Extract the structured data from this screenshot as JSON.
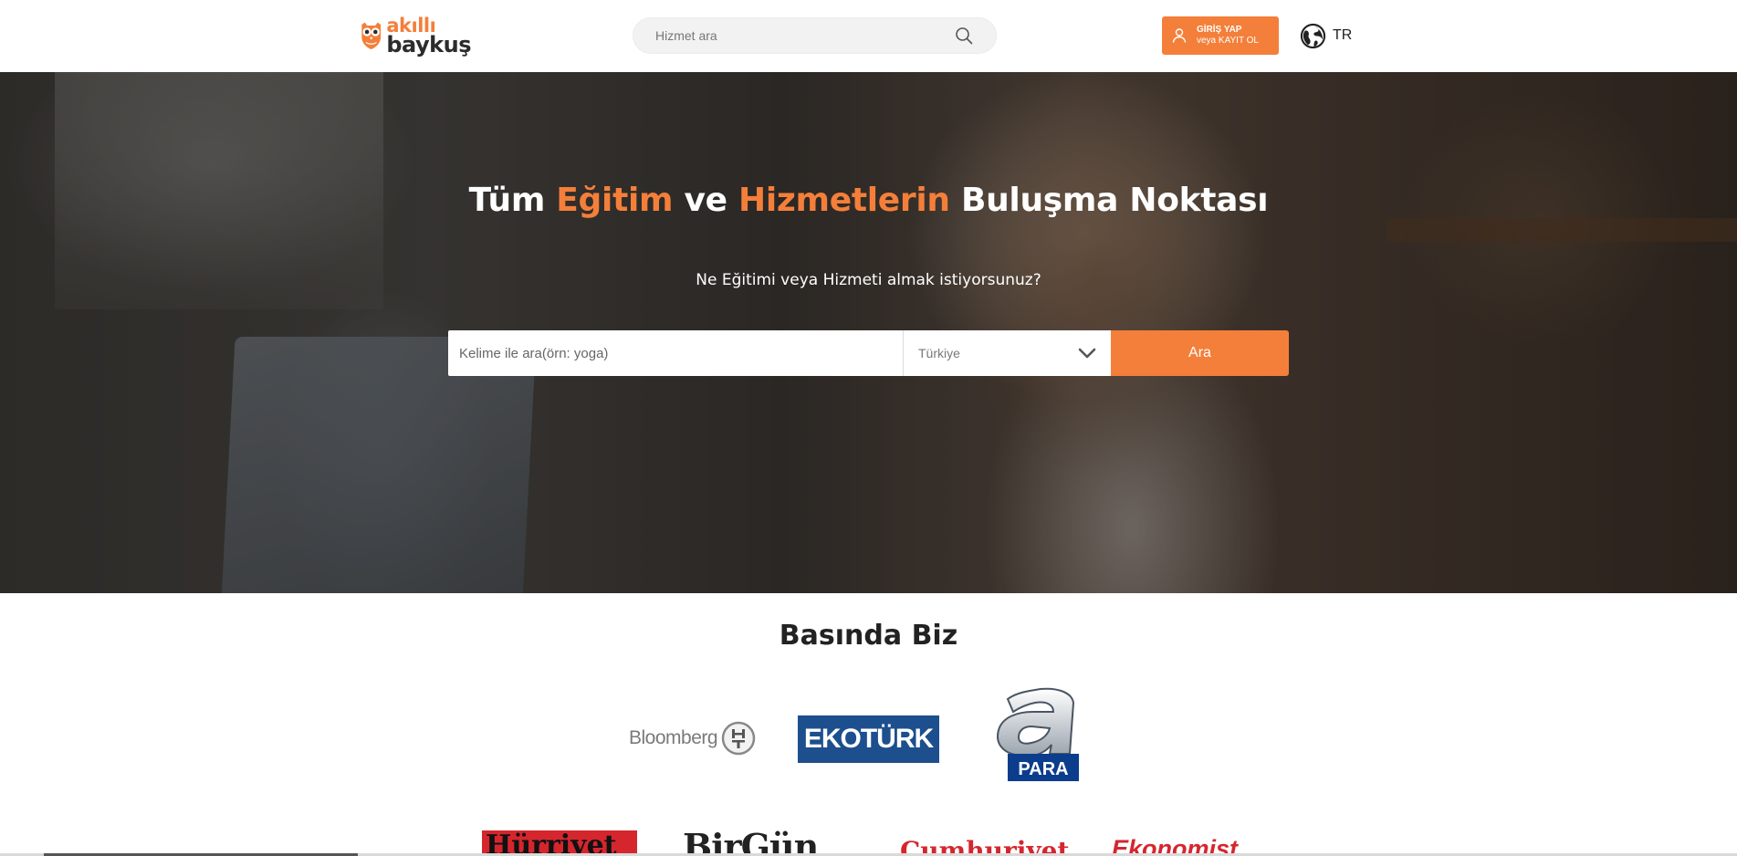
{
  "header": {
    "logo": {
      "line1": "akıllı",
      "line2": "baykuş"
    },
    "search": {
      "placeholder": "Hizmet ara",
      "icon": "search-icon"
    },
    "login": {
      "line1": "GİRİŞ YAP",
      "line2": "veya KAYIT OL",
      "icon": "user-icon"
    },
    "language": {
      "code": "TR",
      "icon": "globe-icon"
    }
  },
  "hero": {
    "title": {
      "part1": "Tüm ",
      "accent1": "Eğitim",
      "part2": " ve ",
      "accent2": "Hizmetlerin",
      "part3": " Buluşma Noktası"
    },
    "subtitle": "Ne Eğitimi veya Hizmeti almak istiyorsunuz?",
    "search": {
      "keyword_placeholder": "Kelime ile ara(örn: yoga)",
      "country_value": "Türkiye",
      "button_label": "Ara"
    }
  },
  "press": {
    "title": "Basında Biz",
    "logos_row1": {
      "bloomberg": "Bloomberg",
      "bloomberg_badge": "HT",
      "ekoturk": "EKOTÜRK",
      "apara": "PARA"
    },
    "logos_row2": {
      "hurriyet": "Hürriyet",
      "birgun": "BirGün",
      "cumhuriyet": "Cumhuriyet",
      "ekonomist": "Ekonomist"
    }
  },
  "colors": {
    "accent": "#f47f3a",
    "ekoturk_blue": "#1d4f8e",
    "red": "#d5262e"
  }
}
